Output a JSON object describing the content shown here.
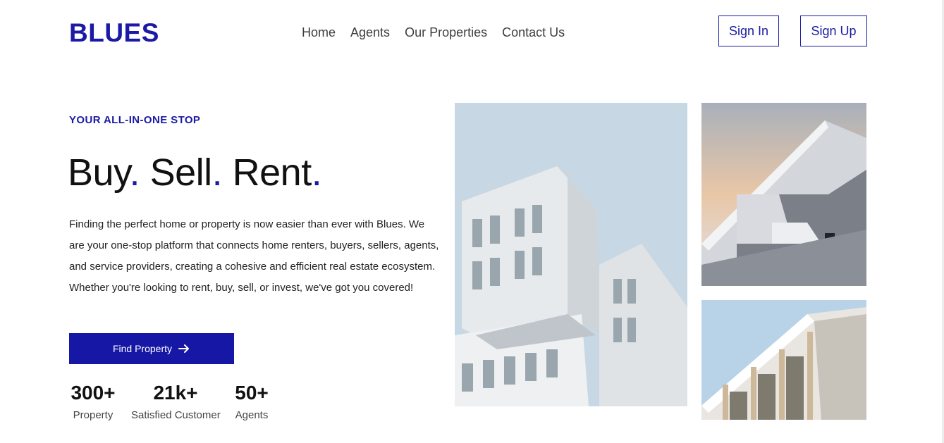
{
  "brand": {
    "logo": "BLUES",
    "accent": "#1a1aa6"
  },
  "nav": {
    "items": [
      "Home",
      "Agents",
      "Our Properties",
      "Contact Us"
    ]
  },
  "auth": {
    "sign_in": "Sign In",
    "sign_up": "Sign Up"
  },
  "hero": {
    "tagline": "YOUR ALL-IN-ONE STOP",
    "headline_words": [
      "Buy",
      "Sell",
      "Rent"
    ],
    "headline_dot": ".",
    "description": "Finding the perfect home or property is now easier than ever with Blues. We are your one-stop platform that connects home renters, buyers, sellers, agents, and service providers, creating a cohesive and efficient real estate ecosystem. Whether you're looking to rent, buy, sell, or invest, we've got you covered!",
    "cta_label": "Find Property",
    "cta_icon": "arrow-right-icon"
  },
  "stats": [
    {
      "value": "300+",
      "label": "Property"
    },
    {
      "value": "21k+",
      "label": "Satisfied Customer"
    },
    {
      "value": "50+",
      "label": "Agents"
    }
  ],
  "images": [
    "building-photo-main",
    "building-photo-top",
    "building-photo-bottom"
  ]
}
